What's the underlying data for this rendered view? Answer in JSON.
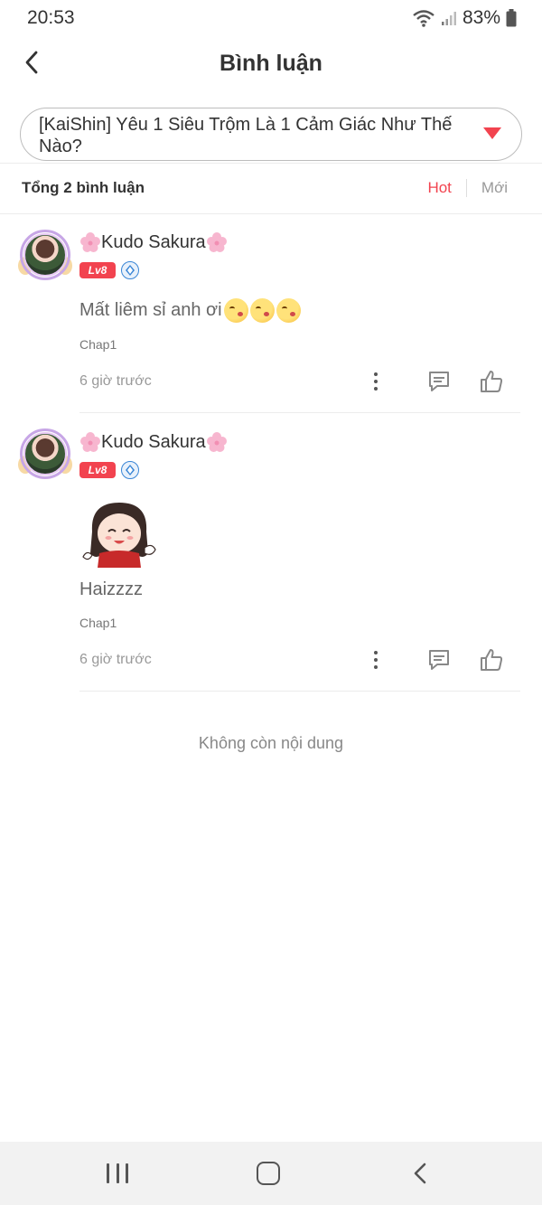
{
  "status_bar": {
    "time": "20:53",
    "battery": "83%"
  },
  "header": {
    "title": "Bình luận",
    "back_icon": "chevron-left-icon"
  },
  "chapter_selector": {
    "value": "[KaiShin] Yêu 1 Siêu Trộm Là 1 Cảm Giác Như Thế Nào?",
    "arrow_color": "#f2434f"
  },
  "summary": {
    "total": "Tổng 2 bình luận",
    "tabs": [
      {
        "label": "Hot",
        "active": true
      },
      {
        "label": "Mới",
        "active": false
      }
    ]
  },
  "comments": [
    {
      "username": "Kudo Sakura",
      "level": "Lv8",
      "text": "Mất liêm sỉ anh ơi",
      "emoji_count": 3,
      "chapter": "Chap1",
      "time": "6 giờ trước"
    },
    {
      "username": "Kudo Sakura",
      "level": "Lv8",
      "sticker": "chibi-girl-sticker",
      "text": "Haizzzz",
      "chapter": "Chap1",
      "time": "6 giờ trước"
    }
  ],
  "end_message": "Không còn nội dung",
  "colors": {
    "accent": "#f2434f",
    "muted": "#999999"
  }
}
